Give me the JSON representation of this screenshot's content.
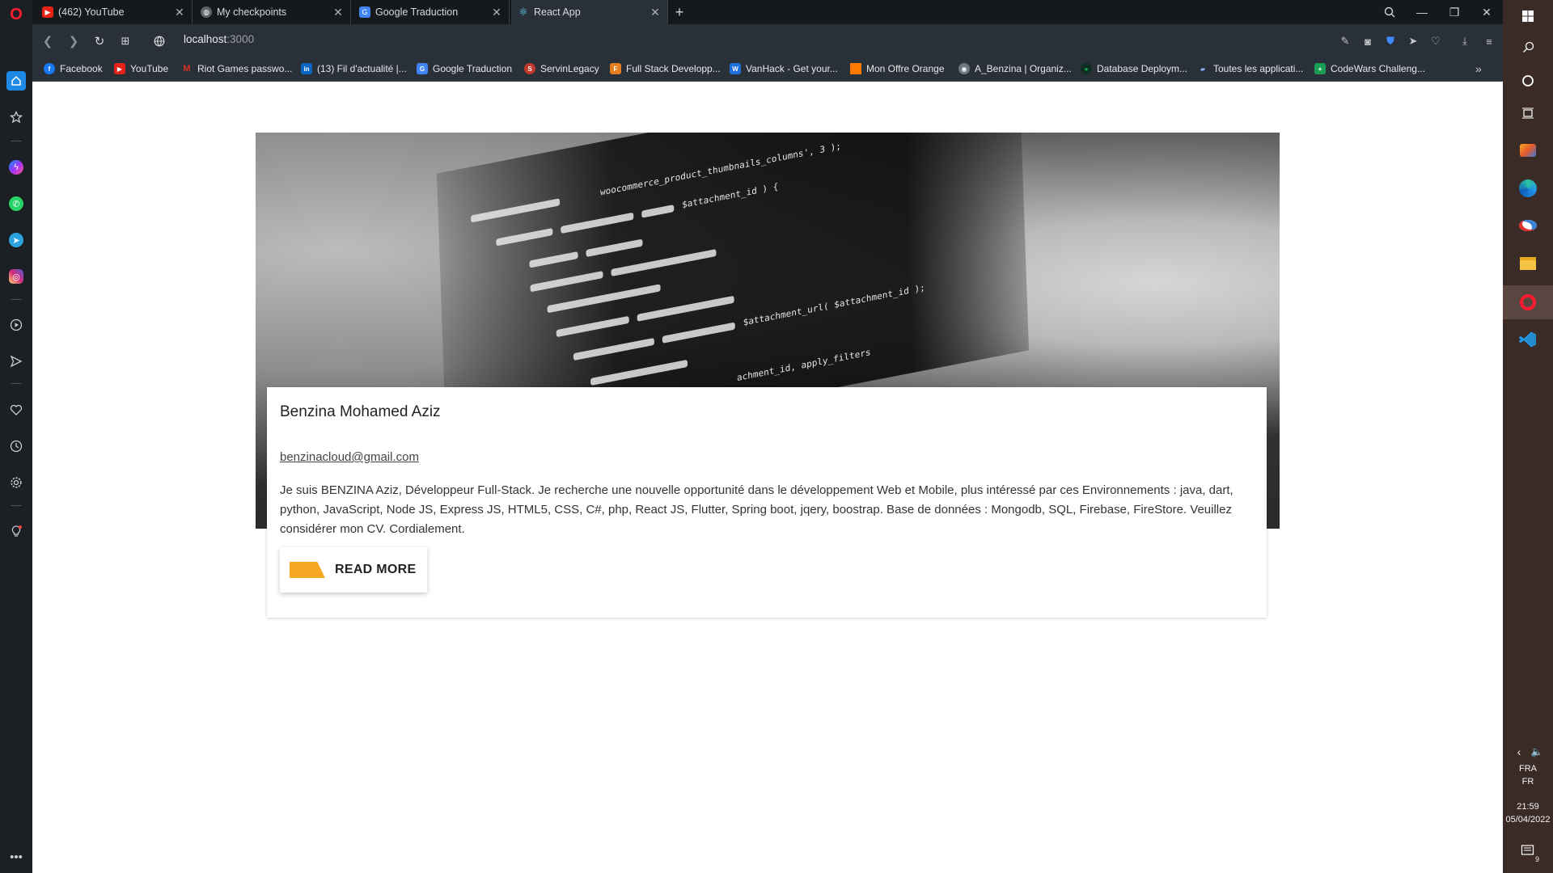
{
  "tabs": [
    {
      "title": "(462) YouTube",
      "icon": "youtube-icon",
      "color": "#e62117"
    },
    {
      "title": "My checkpoints",
      "icon": "globe-icon",
      "color": "#5f6368"
    },
    {
      "title": "Google Traduction",
      "icon": "google-translate-icon",
      "color": "#4285f4"
    },
    {
      "title": "React App",
      "icon": "react-icon",
      "color": "#61dafb"
    }
  ],
  "new_tab_label": "+",
  "address": {
    "host": "localhost",
    "port": ":3000"
  },
  "bookmarks": [
    {
      "label": "Facebook",
      "icon": "facebook-icon",
      "color": "#1877f2",
      "glyph": "f"
    },
    {
      "label": "YouTube",
      "icon": "youtube-icon",
      "color": "#e62117",
      "glyph": "▶"
    },
    {
      "label": "Riot Games passwo...",
      "icon": "gmail-icon",
      "color": "#d93025",
      "glyph": "M"
    },
    {
      "label": "(13) Fil d'actualité |...",
      "icon": "linkedin-icon",
      "color": "#0a66c2",
      "glyph": "in"
    },
    {
      "label": "Google Traduction",
      "icon": "google-translate-icon",
      "color": "#4285f4",
      "glyph": "G"
    },
    {
      "label": "ServinLegacy",
      "icon": "servinlegacy-icon",
      "color": "#c0392b",
      "glyph": "S"
    },
    {
      "label": "Full Stack Developp...",
      "icon": "fullstack-icon",
      "color": "#e67e22",
      "glyph": "F"
    },
    {
      "label": "VanHack - Get your...",
      "icon": "vanhack-icon",
      "color": "#1e6fd9",
      "glyph": "W"
    },
    {
      "label": "Mon Offre Orange",
      "icon": "orange-icon",
      "color": "#ff7900",
      "glyph": ""
    },
    {
      "label": "A_Benzina | Organiz...",
      "icon": "github-icon",
      "color": "#6e7681",
      "glyph": "◉"
    },
    {
      "label": "Database Deploym...",
      "icon": "mongodb-icon",
      "color": "#13aa52",
      "glyph": "●"
    },
    {
      "label": "Toutes les applicati...",
      "icon": "apps-icon",
      "color": "#5b8def",
      "glyph": "▰"
    },
    {
      "label": "CodeWars Challeng...",
      "icon": "codewars-icon",
      "color": "#1a9e56",
      "glyph": "+"
    }
  ],
  "profile": {
    "name": "Benzina Mohamed Aziz",
    "email": "benzinacloud@gmail.com",
    "bio": "Je suis BENZINA Aziz, Développeur Full-Stack. Je recherche une nouvelle opportunité dans le développement Web et Mobile, plus intéressé par ces Environnements : java, dart, python, JavaScript, Node JS, Express JS, HTML5, CSS, C#, php, React JS, Flutter, Spring boot, jqery, boostrap. Base de données : Mongodb, SQL, Firebase, FireStore. Veuillez considérer mon CV. Cordialement.",
    "read_more_label": "READ MORE",
    "accent_color": "#f7a823"
  },
  "hero_code": [
    "woocommerce_product_thumbnails_columns', 3 );",
    "$attachment_id ) {",
    "$attachment_url( $attachment_id );",
    "achment_id, apply_filters"
  ],
  "taskbar": {
    "lang_top": "FRA",
    "lang_bottom": "FR",
    "time": "21:59",
    "date": "05/04/2022",
    "notification_count": "9"
  }
}
